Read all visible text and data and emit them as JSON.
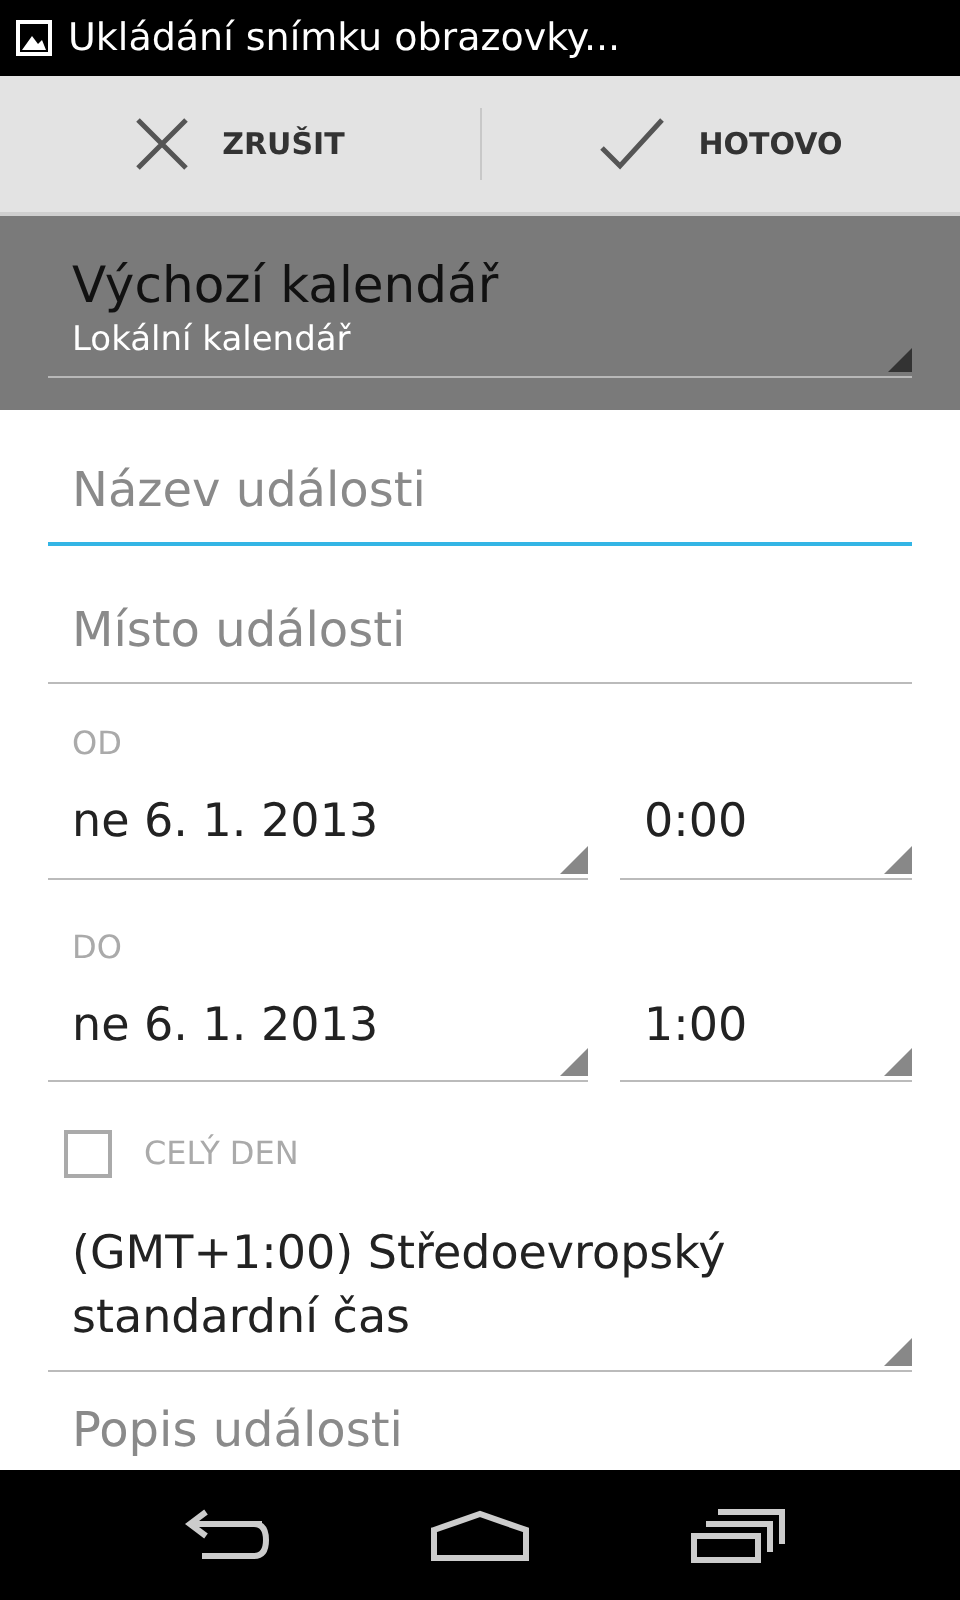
{
  "status_bar": {
    "notification": "Ukládání snímku obrazovky..."
  },
  "action_bar": {
    "buttons": [
      {
        "kind": "cancel",
        "label": "ZRUŠIT"
      },
      {
        "kind": "done",
        "label": "HOTOVO"
      }
    ]
  },
  "calendar": {
    "title": "Výchozí kalendář",
    "value": "Lokální kalendář"
  },
  "title_field": {
    "placeholder": "Název události",
    "focused": true
  },
  "location_field": {
    "placeholder": "Místo události",
    "focused": false
  },
  "from": {
    "label": "OD",
    "date": "ne 6. 1. 2013",
    "time": "0:00"
  },
  "to": {
    "label": "DO",
    "date": "ne 6. 1. 2013",
    "time": "1:00"
  },
  "all_day": {
    "label": "CELÝ DEN",
    "checked": false
  },
  "timezone": {
    "value": "(GMT+1:00) Středoevropský standardní čas"
  },
  "description_field": {
    "placeholder": "Popis události"
  }
}
